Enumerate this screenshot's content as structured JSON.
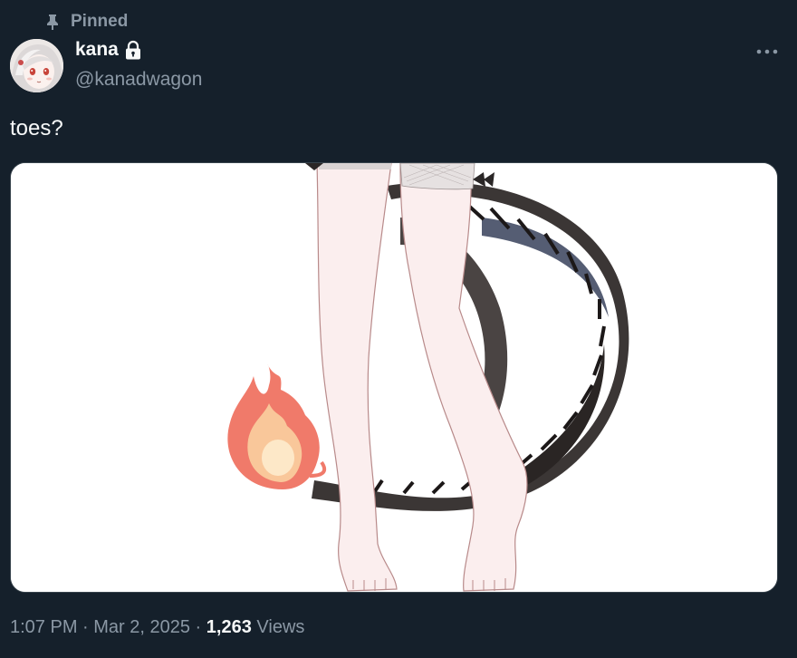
{
  "pinned": {
    "label": "Pinned",
    "icon": "pin-icon"
  },
  "author": {
    "display_name": "kana",
    "handle": "@kanadwagon",
    "protected_icon": "lock-icon",
    "avatar_icon": "avatar"
  },
  "more_icon": "more-horizontal-icon",
  "tweet": {
    "text": "toes?",
    "time": "1:07 PM",
    "separator": " · ",
    "date": "Mar 2, 2025",
    "views_count": "1,263",
    "views_label": " Views"
  },
  "colors": {
    "background": "#15202b",
    "text_primary": "#f7f9f9",
    "text_secondary": "#8b98a5",
    "border": "#38444d"
  }
}
